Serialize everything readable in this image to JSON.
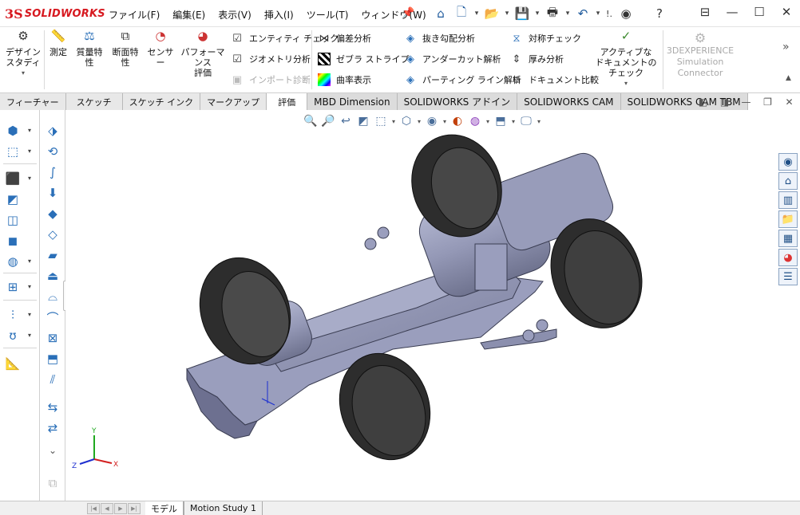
{
  "app": {
    "logo_mark": "3S",
    "logo_text": "SOLIDWORKS"
  },
  "menu": [
    "ファイル(F)",
    "編集(E)",
    "表示(V)",
    "挿入(I)",
    "ツール(T)",
    "ウィンドウ(W)"
  ],
  "titlebar": {
    "user_label": "!.",
    "icons": [
      "home-icon",
      "new-document-icon",
      "open-icon",
      "save-icon",
      "print-icon",
      "undo-icon",
      "user-icon",
      "help-icon"
    ],
    "window_controls": [
      "restore-window-icon",
      "minimize-icon",
      "maximize-icon",
      "close-icon"
    ]
  },
  "ribbon": {
    "design_study": "デザイン\nスタディ",
    "measure": "測定",
    "mass_properties": "質量特\n性",
    "section_properties": "断面特\n性",
    "sensor": "センサー",
    "performance_eval": "パフォーマンス\n評価",
    "entity_check": "エンティティ チェック",
    "geometry_analysis": "ジオメトリ分析",
    "import_diagnosis": "インポート診断",
    "deviation_analysis": "偏差分析",
    "zebra_stripes": "ゼブラ ストライプ",
    "curvature": "曲率表示",
    "draft_analysis": "抜き勾配分析",
    "undercut_analysis": "アンダーカット解析",
    "parting_line_analysis": "パーティング ライン解析",
    "symmetry_check": "対称チェック",
    "thickness_analysis": "厚み分析",
    "compare_documents": "ドキュメント比較",
    "check_active_document": "アクティブな\nドキュメントのチェック",
    "sim_connector": "3DEXPERIENCE\nSimulation\nConnector"
  },
  "tabs": [
    {
      "label": "フィーチャー",
      "active": false
    },
    {
      "label": "スケッチ",
      "active": false
    },
    {
      "label": "スケッチ インク",
      "active": false
    },
    {
      "label": "マークアップ",
      "active": false
    },
    {
      "label": "評価",
      "active": true
    },
    {
      "label": "MBD Dimension",
      "active": false
    },
    {
      "label": "SOLIDWORKS アドイン",
      "active": false
    },
    {
      "label": "SOLIDWORKS CAM",
      "active": false
    },
    {
      "label": "SOLIDWORKS CAM TBM",
      "active": false
    }
  ],
  "triad": {
    "x": "X",
    "y": "Y",
    "z": "Z"
  },
  "bottom_tabs": [
    {
      "label": "モデル",
      "active": true
    },
    {
      "label": "Motion Study 1",
      "active": false
    }
  ],
  "colors": {
    "brand_red": "#d71920",
    "body_gray": "#8b8fb0",
    "tire": "#3a3a3a"
  }
}
